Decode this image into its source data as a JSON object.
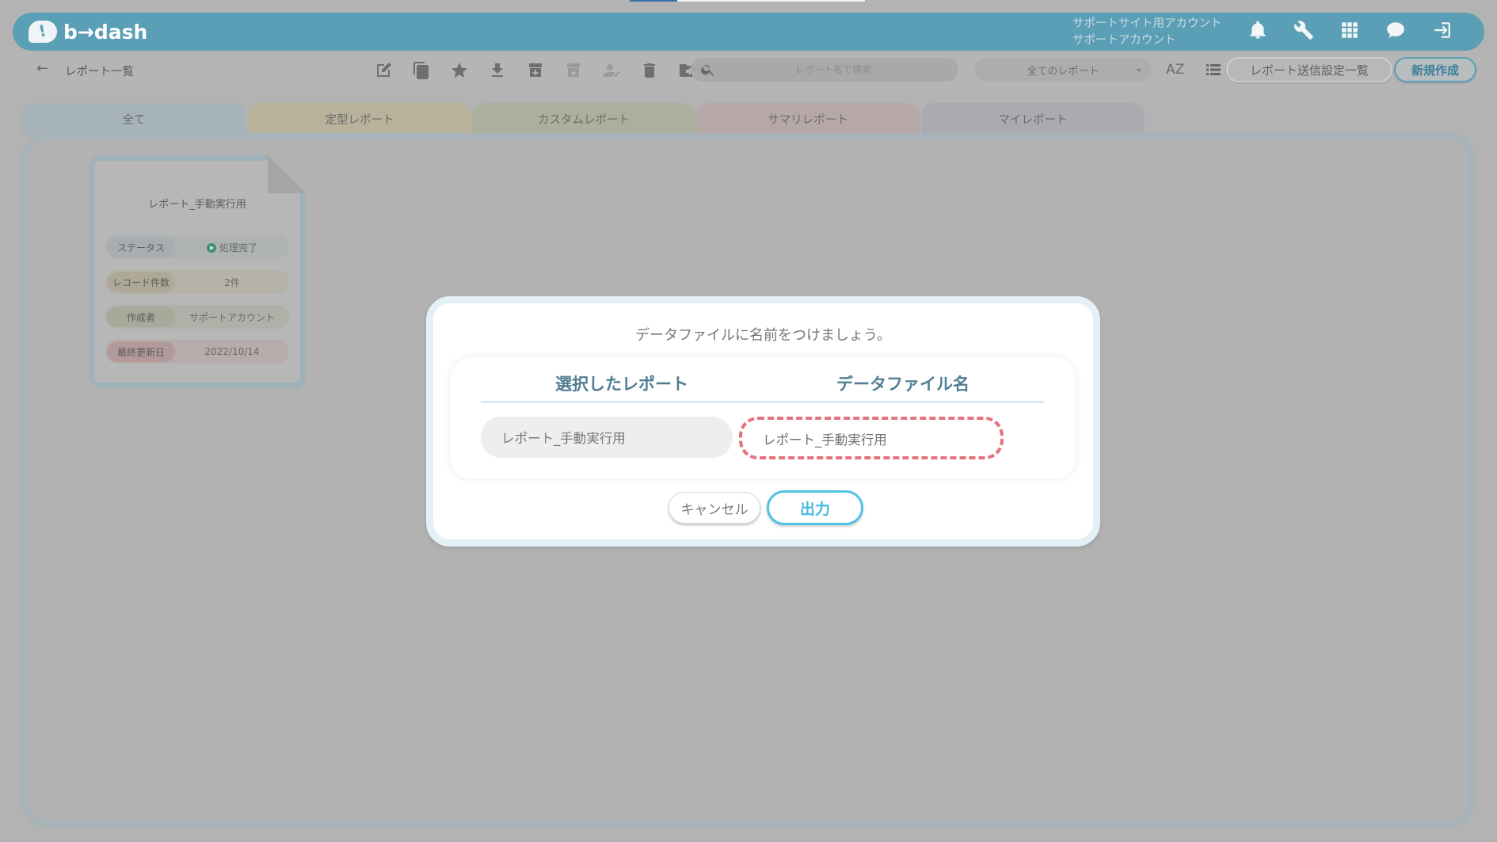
{
  "app": {
    "logo_text": "b→dash",
    "account_line1": "サポートサイト用アカウント",
    "account_line2": "サポートアカウント"
  },
  "header_icons": [
    "bell-icon",
    "wrench-icon",
    "apps-grid-icon",
    "chat-notification-icon",
    "logout-icon"
  ],
  "toolbar": {
    "breadcrumb": "レポート一覧",
    "search_placeholder": "レポート名で検索",
    "filter_value": "全てのレポート",
    "sort_label": "AZ",
    "send_settings_label": "レポート送信設定一覧",
    "new_label": "新規作成"
  },
  "tabs": [
    {
      "label": "全て",
      "color": "#a6b3b9"
    },
    {
      "label": "定型レポート",
      "color": "#b8b29a"
    },
    {
      "label": "カスタムレポート",
      "color": "#abb09e"
    },
    {
      "label": "サマリレポート",
      "color": "#b7a8a8"
    },
    {
      "label": "マイレポート",
      "color": "#ada9b1"
    }
  ],
  "report_card": {
    "title": "レポート_手動実行用",
    "rows": [
      {
        "label": "ステータス",
        "value": "処理完了"
      },
      {
        "label": "レコード件数",
        "value": "2件"
      },
      {
        "label": "作成者",
        "value": "サポートアカウント"
      },
      {
        "label": "最終更新日",
        "value": "2022/10/14"
      }
    ]
  },
  "modal": {
    "prompt": "データファイルに名前をつけましょう。",
    "col_selected": "選択したレポート",
    "col_filename": "データファイル名",
    "selected_report": "レポート_手動実行用",
    "filename_value": "レポート_手動実行用",
    "cancel_label": "キャンセル",
    "output_label": "出力",
    "accent_color": "#4ec3e6",
    "highlight_color": "#e5727c"
  }
}
